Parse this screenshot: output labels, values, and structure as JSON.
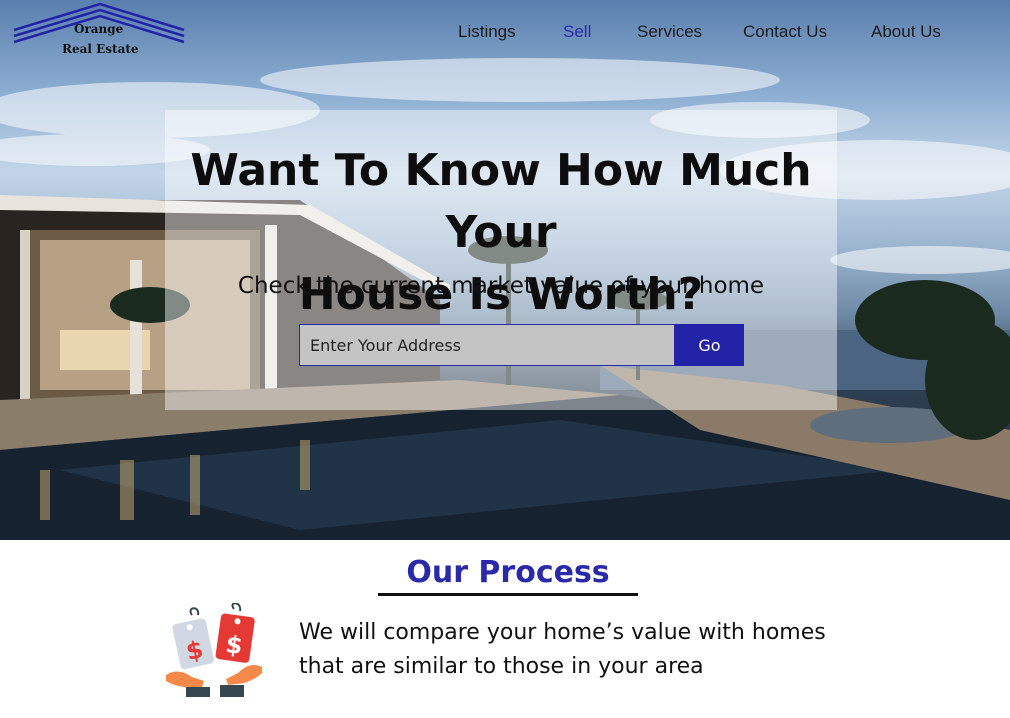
{
  "brand": {
    "line1": "Orange",
    "line2": "Real Estate",
    "logo_icon": "roof-logo-icon"
  },
  "nav": {
    "items": [
      {
        "label": "Listings",
        "active": false
      },
      {
        "label": "Sell",
        "active": true
      },
      {
        "label": "Services",
        "active": false
      },
      {
        "label": "Contact Us",
        "active": false
      },
      {
        "label": "About Us",
        "active": false
      }
    ],
    "active_color": "#2a2aa8"
  },
  "hero": {
    "title_line1": "Want To Know How Much Your",
    "title_line2": "House Is Worth?",
    "subtitle": "Check the current market value of your home",
    "background_image": "modern-house-pool-dusk-photo",
    "search": {
      "placeholder": "Enter Your Address",
      "value": "",
      "button_label": "Go"
    }
  },
  "process": {
    "title": "Our Process",
    "icon": "price-tags-hands-icon",
    "description_line1": "We will compare your home’s value with homes",
    "description_line2": "that are similar to those in your area"
  },
  "colors": {
    "accent": "#2a2aa8",
    "button": "#2323a8",
    "input_bg": "#c4c4c4",
    "tag_red": "#e53935",
    "tag_light": "#cfd8e3",
    "hand": "#f5894a"
  }
}
